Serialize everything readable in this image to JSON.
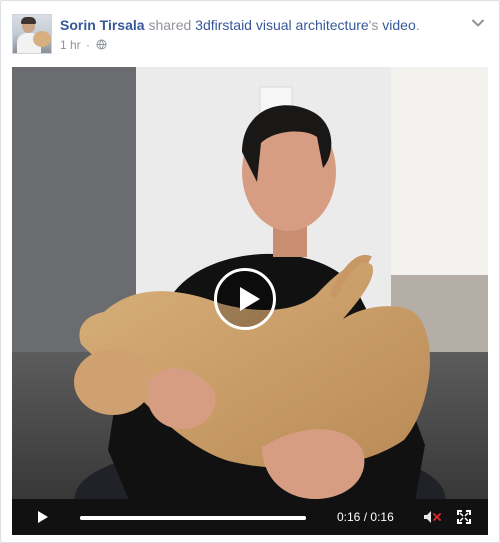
{
  "post": {
    "actor_name": "Sorin Tirsala",
    "action_text": "shared",
    "source_page": "3dfirstaid visual architecture",
    "possessive": "'s",
    "object_text": "video",
    "period": ".",
    "time_ago": "1 hr",
    "separator": "·",
    "privacy_icon": "globe-icon",
    "menu_icon": "chevron-down-icon",
    "avatar_icon": "profile-photo"
  },
  "video": {
    "current_time": "0:16",
    "time_separator": "/",
    "duration": "0:16",
    "progress": 1.0,
    "big_play_icon": "play-icon",
    "controls": {
      "play_icon": "play-icon",
      "mute_icon": "muted-speaker-icon",
      "fullscreen_icon": "fullscreen-icon"
    }
  },
  "colors": {
    "link": "#365899",
    "meta": "#90949c",
    "controls_bg": "#111111",
    "mute_accent": "#e02a2a"
  }
}
